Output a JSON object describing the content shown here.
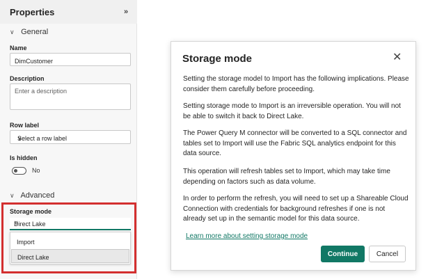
{
  "properties": {
    "title": "Properties",
    "collapse_icon": "»",
    "sections": {
      "general": "General",
      "advanced": "Advanced"
    },
    "name": {
      "label": "Name",
      "value": "DimCustomer"
    },
    "description": {
      "label": "Description",
      "placeholder": "Enter a description"
    },
    "row_label": {
      "label": "Row label",
      "placeholder": "Select a row label"
    },
    "is_hidden": {
      "label": "Is hidden",
      "state": "No"
    },
    "storage_mode": {
      "label": "Storage mode",
      "value": "Direct Lake",
      "options": [
        "Import",
        "Direct Lake"
      ]
    }
  },
  "dialog": {
    "title": "Storage mode",
    "close_icon": "✕",
    "paragraphs": [
      "Setting the storage model to Import has the following implications. Please consider them carefully before proceeding.",
      "Setting storage mode to Import is an irreversible operation. You will not be able to switch it back to Direct Lake.",
      "The Power Query M connector will be converted to a SQL connector and tables set to Import will use the Fabric SQL analytics endpoint for this data source.",
      "This operation will refresh tables set to Import, which may take time depending on factors such as data volume.",
      "In order to perform the refresh, you will need to set up a Shareable Cloud Connection with credentials for background refreshes if one is not already set up in the semantic model for this data source."
    ],
    "link": "Learn more about setting storage mode",
    "continue_label": "Continue",
    "cancel_label": "Cancel"
  },
  "colors": {
    "accent": "#117865",
    "highlight": "#d32f2f"
  }
}
